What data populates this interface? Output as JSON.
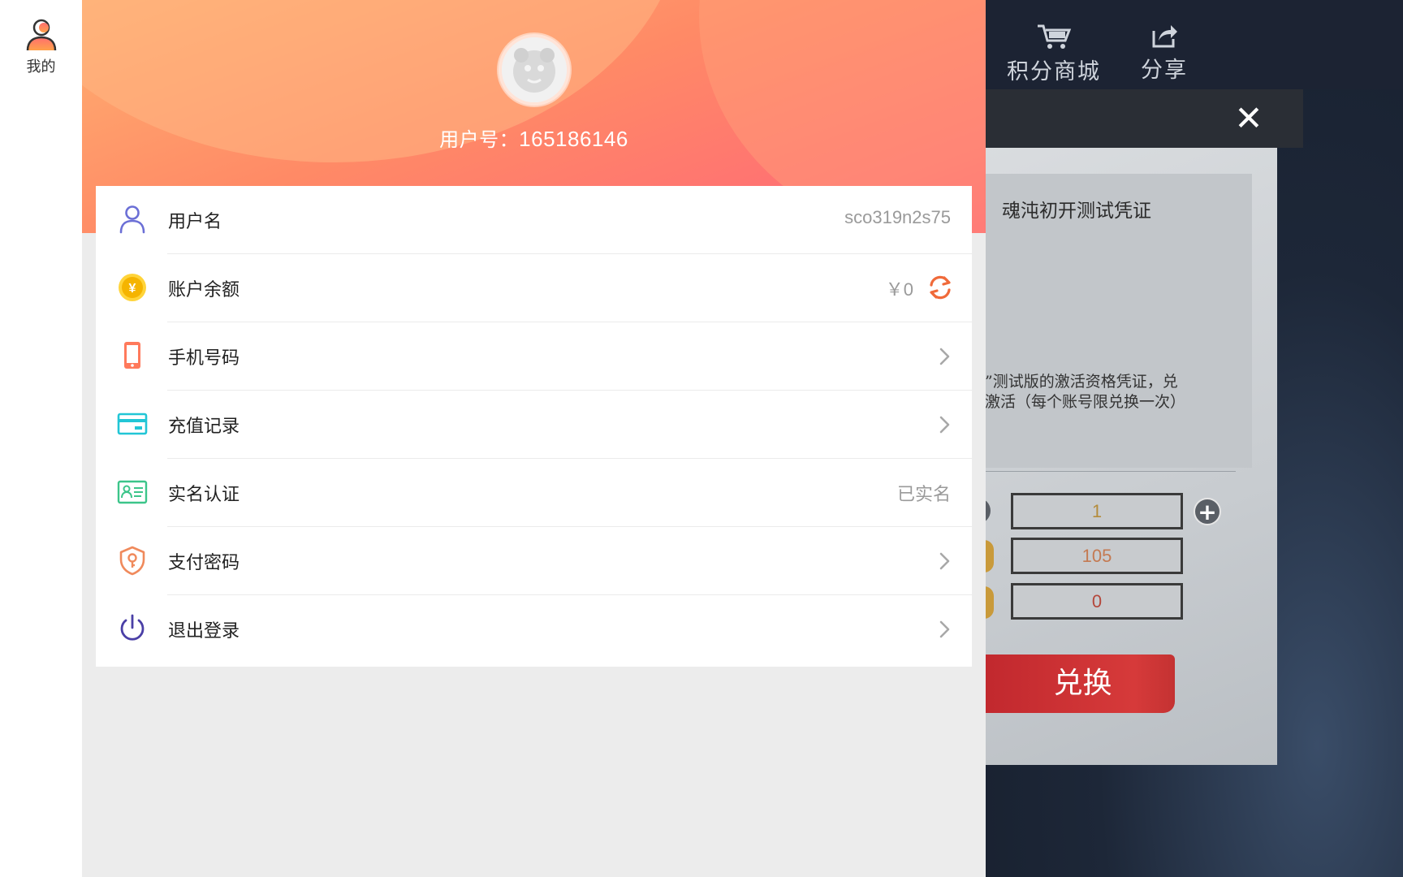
{
  "nav": {
    "me_label": "我的",
    "me_icon": "user-icon"
  },
  "profile": {
    "user_id_label": "用户号：",
    "user_id": "165186146"
  },
  "menu": {
    "items": [
      {
        "label": "用户名",
        "icon": "user-outline-icon",
        "value": "sco319n2s75"
      },
      {
        "label": "账户余额",
        "icon": "coin-icon",
        "value": "￥0",
        "action_icon": "refresh-icon"
      },
      {
        "label": "手机号码",
        "icon": "phone-icon",
        "action_icon": "chevron-right-icon"
      },
      {
        "label": "充值记录",
        "icon": "card-icon",
        "action_icon": "chevron-right-icon"
      },
      {
        "label": "实名认证",
        "icon": "id-card-icon",
        "value": "已实名"
      },
      {
        "label": "支付密码",
        "icon": "shield-key-icon",
        "action_icon": "chevron-right-icon"
      },
      {
        "label": "退出登录",
        "icon": "power-icon",
        "action_icon": "chevron-right-icon"
      }
    ]
  },
  "game": {
    "shop_label": "积分商城",
    "share_label": "分享",
    "item_title": "魂沌初开测试凭证",
    "desc_line1": "开”测试版的激活资格凭证，兑",
    "desc_line2": "动激活（每个账号限兑换一次）",
    "quantity": "1",
    "price": "105",
    "balance": "0",
    "redeem_label": "兑换"
  },
  "colors": {
    "accent_red": "#c0272d",
    "hero_gradient_start": "#ffb070",
    "hero_gradient_end": "#ff5c75",
    "refresh": "#f06a3a"
  }
}
